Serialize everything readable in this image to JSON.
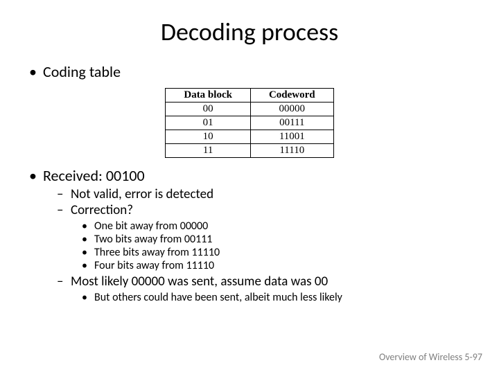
{
  "title": "Decoding process",
  "bullets": {
    "b1": "Coding table",
    "b2": "Received: 00100",
    "b2_sub": {
      "s1": "Not valid, error is detected",
      "s2": "Correction?",
      "s2_sub": {
        "d1": "One bit away from 00000",
        "d2": "Two bits away from 00111",
        "d3": "Three bits away from 11110",
        "d4": "Four bits away from 11110"
      },
      "s3": "Most likely 00000 was sent, assume data was 00",
      "s3_sub": {
        "d1": "But others could have been sent, albeit much less likely"
      }
    }
  },
  "table": {
    "headers": {
      "c1": "Data block",
      "c2": "Codeword"
    },
    "rows": [
      {
        "c1": "00",
        "c2": "00000"
      },
      {
        "c1": "01",
        "c2": "00111"
      },
      {
        "c1": "10",
        "c2": "11001"
      },
      {
        "c1": "11",
        "c2": "11110"
      }
    ]
  },
  "footer": "Overview of Wireless 5-97"
}
